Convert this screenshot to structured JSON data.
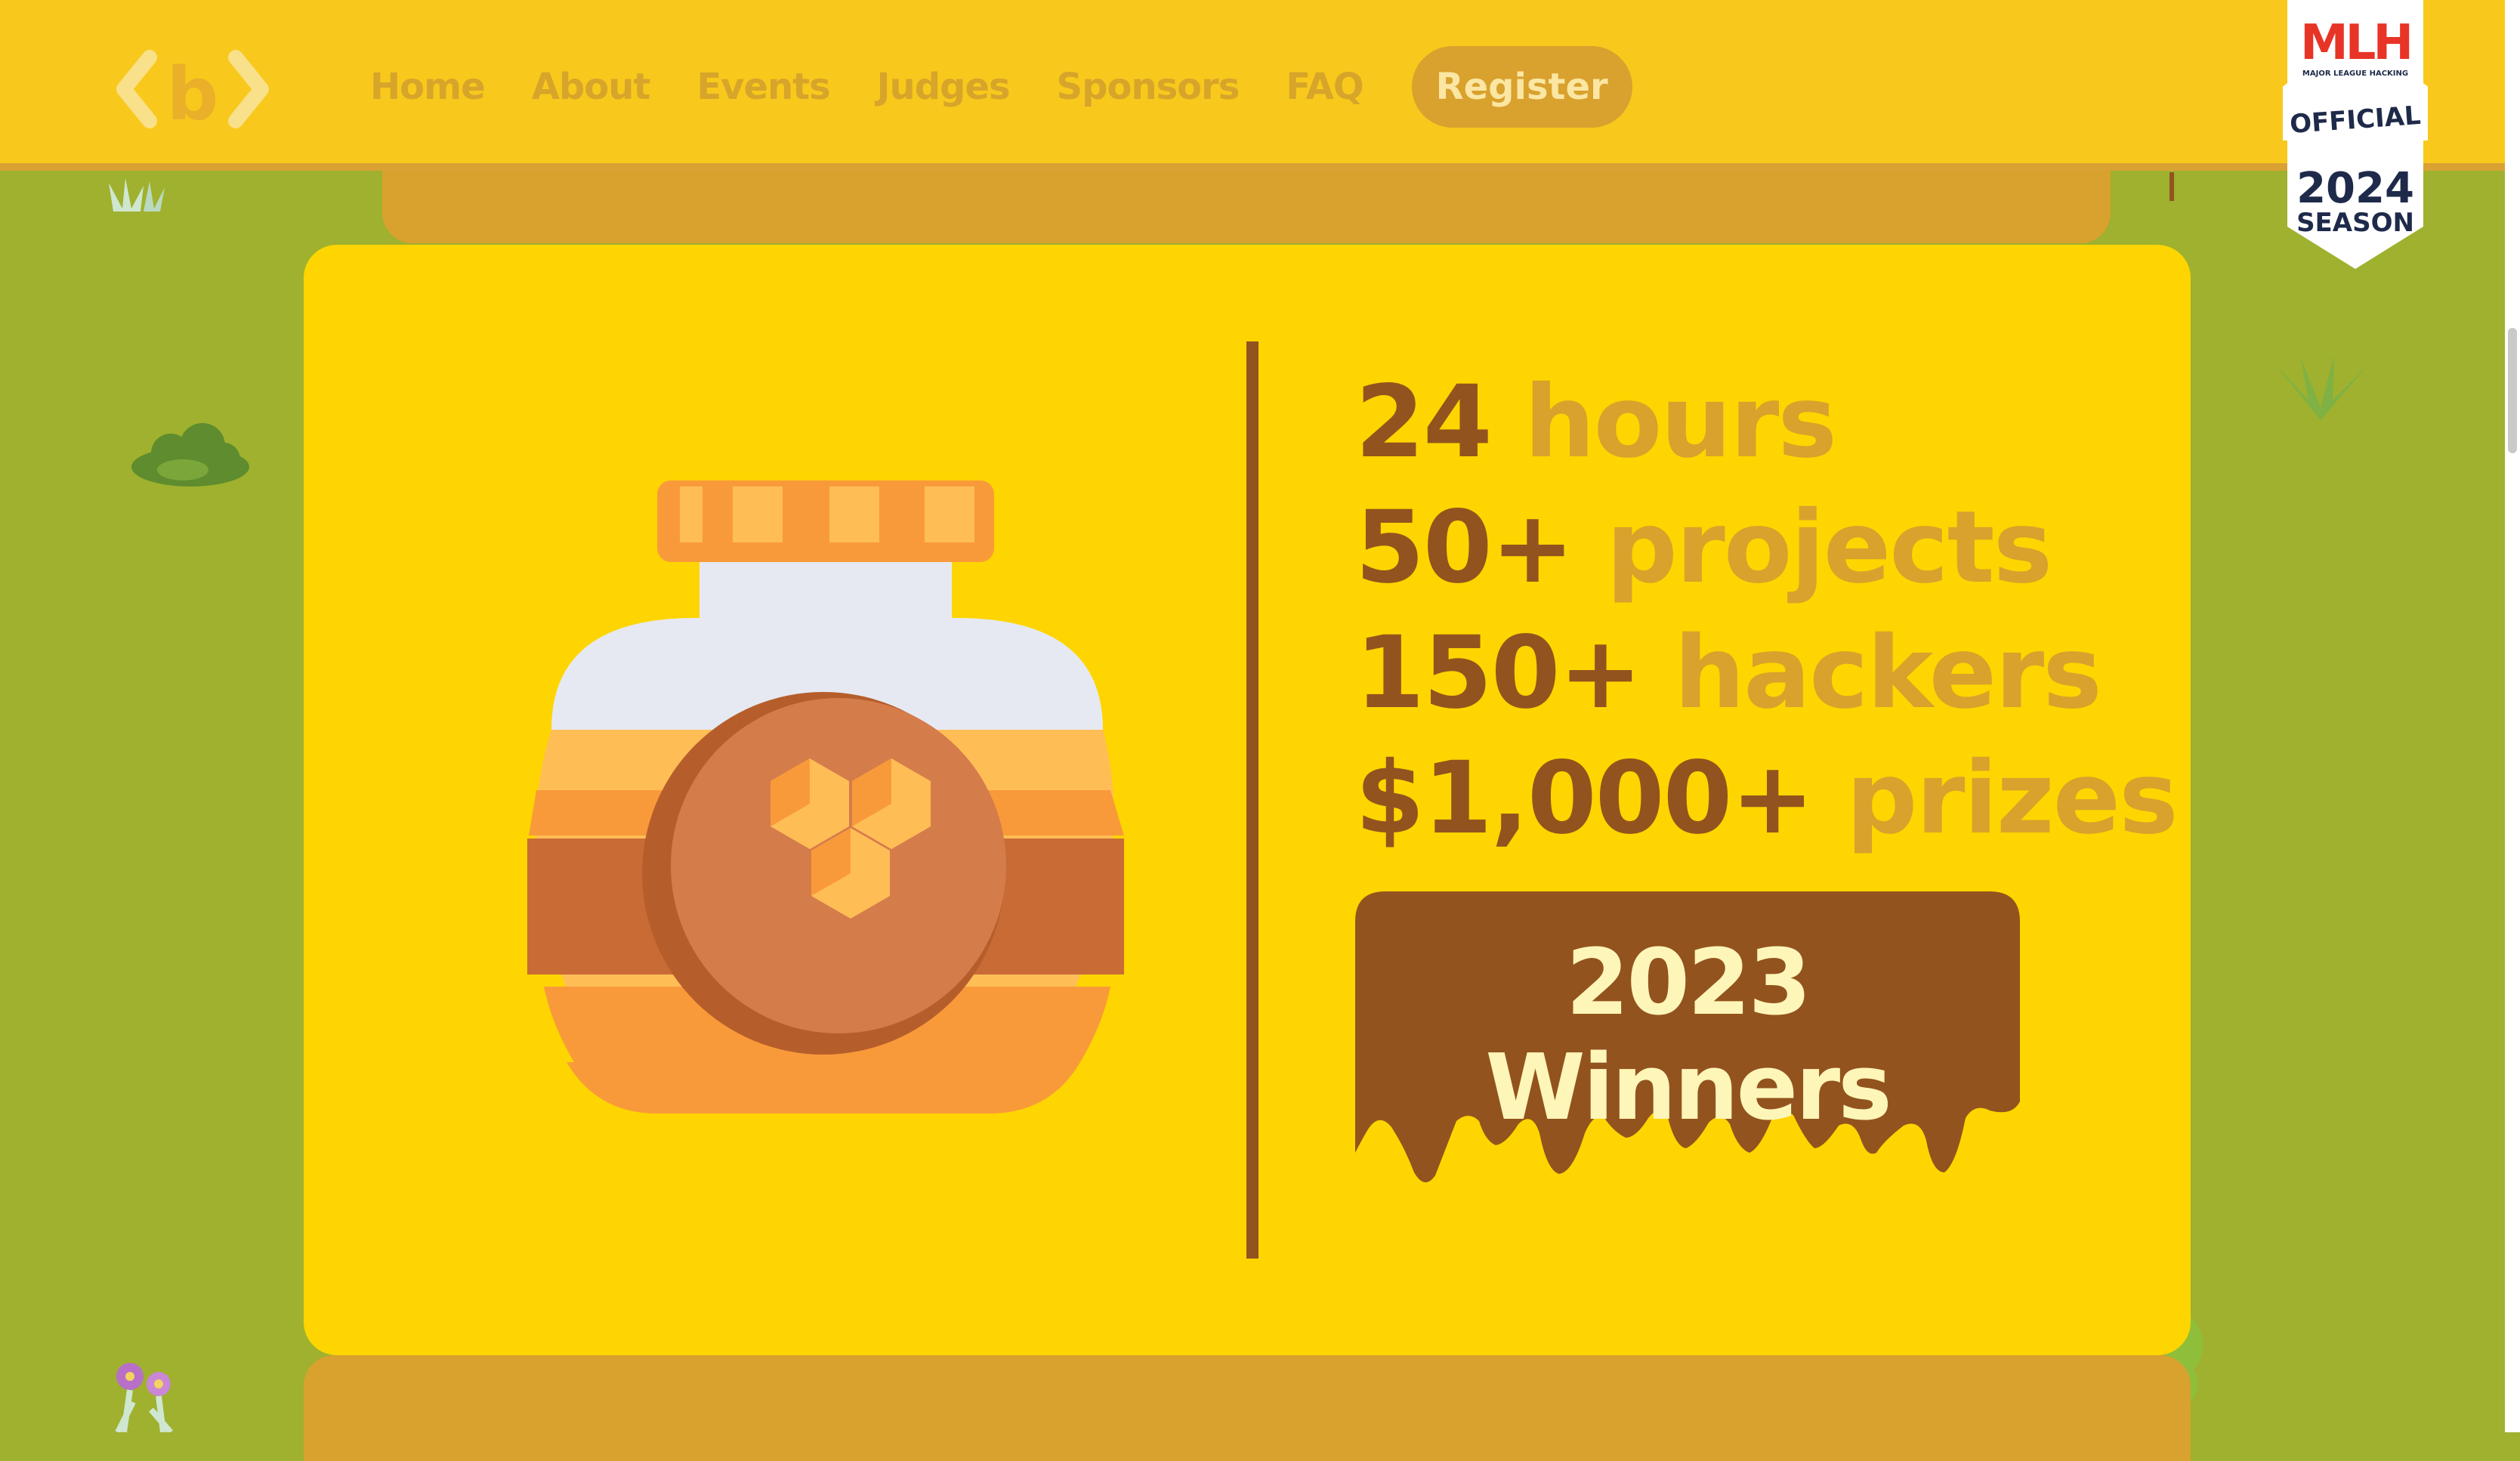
{
  "nav": {
    "logo_text": "b",
    "items": [
      {
        "label": "Home"
      },
      {
        "label": "About"
      },
      {
        "label": "Events"
      },
      {
        "label": "Judges"
      },
      {
        "label": "Sponsors"
      },
      {
        "label": "FAQ"
      }
    ],
    "register_label": "Register"
  },
  "badge": {
    "brand": "MLH",
    "subtitle": "MAJOR LEAGUE HACKING",
    "official": "OFFICIAL",
    "year": "2024",
    "season": "SEASON"
  },
  "stats": [
    {
      "number": "24",
      "label": "hours"
    },
    {
      "number": "50+",
      "label": "projects"
    },
    {
      "number": "150+",
      "label": "hackers"
    },
    {
      "number": "$1,000+",
      "label": "prizes"
    }
  ],
  "winners_button": {
    "label": "2023 Winners"
  },
  "colors": {
    "background_grass": "#9fb12e",
    "navbar": "#f8c91c",
    "card": "#fed500",
    "honey_brown": "#93531e",
    "muted_gold": "#d8a22c"
  },
  "icons": [
    "honey-jar-icon",
    "honeycomb-icon",
    "bush-icon",
    "grass-tuft-icon",
    "flower-icon"
  ]
}
